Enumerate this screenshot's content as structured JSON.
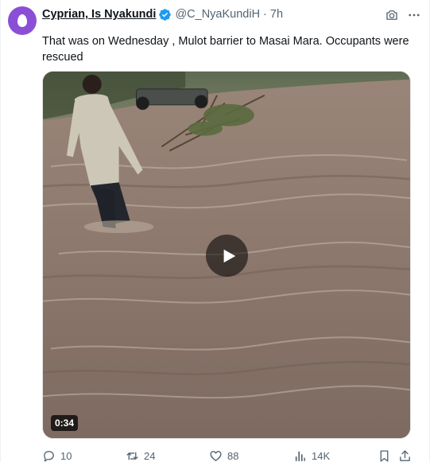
{
  "author": {
    "display_name": "Cyprian, Is Nyakundi",
    "handle": "@C_NyaKundiH",
    "separator": "·",
    "time": "7h",
    "avatar_color": "#8a4fd6",
    "verified_color": "#1d9bf0"
  },
  "tweet": {
    "text": "That was on Wednesday , Mulot barrier to Masai Mara. Occupants were rescued"
  },
  "media": {
    "type": "video",
    "duration": "0:34",
    "play_icon": "play-icon"
  },
  "top_actions": {
    "icons": [
      "camera-icon",
      "more-icon"
    ]
  },
  "stats": {
    "replies": "10",
    "reposts": "24",
    "likes": "88",
    "views": "14K"
  },
  "colors": {
    "text_primary": "#0f1419",
    "text_secondary": "#536471",
    "accent": "#1d9bf0",
    "water": "#8f7b70"
  }
}
